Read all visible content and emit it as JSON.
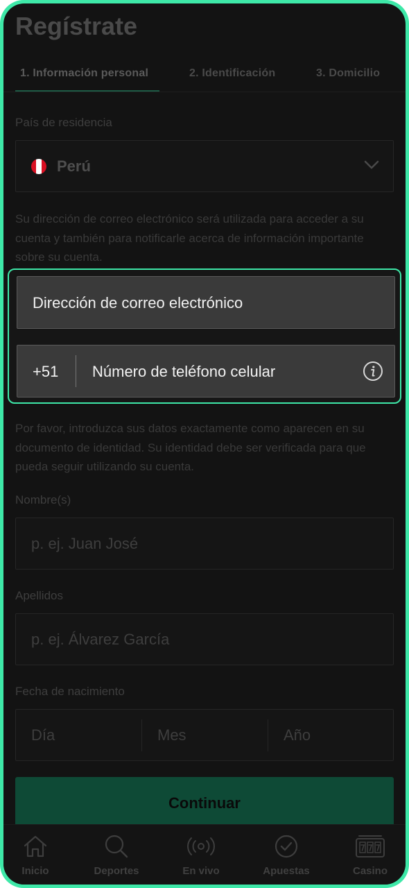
{
  "page_title": "Regístrate",
  "tabs": [
    {
      "label": "1. Información personal"
    },
    {
      "label": "2. Identificación"
    },
    {
      "label": "3. Domicilio"
    }
  ],
  "country": {
    "label": "País de residencia",
    "value": "Perú",
    "flag_colors": [
      "#d91023",
      "#ffffff",
      "#d91023"
    ]
  },
  "email_notice": "Su dirección de correo electrónico será utilizada para acceder a su cuenta y también para notificarle acerca de información importante sobre su cuenta.",
  "email": {
    "placeholder": "Dirección de correo electrónico"
  },
  "phone": {
    "prefix": "+51",
    "placeholder": "Número de teléfono celular",
    "info_icon": "info-icon"
  },
  "identity_notice": "Por favor, introduzca sus datos exactamente como aparecen en su documento de identidad. Su identidad debe ser verificada para que pueda seguir utilizando su cuenta.",
  "first_name": {
    "label": "Nombre(s)",
    "placeholder": "p. ej. Juan José"
  },
  "last_name": {
    "label": "Apellidos",
    "placeholder": "p. ej. Álvarez García"
  },
  "birth_date": {
    "label": "Fecha de nacimiento",
    "day": "Día",
    "month": "Mes",
    "year": "Año"
  },
  "continue_label": "Continuar",
  "nav": [
    {
      "label": "Inicio",
      "icon": "home-icon"
    },
    {
      "label": "Deportes",
      "icon": "search-icon"
    },
    {
      "label": "En vivo",
      "icon": "live-icon"
    },
    {
      "label": "Apuestas",
      "icon": "check-circle-icon"
    },
    {
      "label": "Casino",
      "icon": "slot-machine-icon"
    }
  ],
  "colors": {
    "accent_highlight": "#3ee8a8",
    "cta_bg": "#0e4a36",
    "screen_bg": "#131313"
  }
}
